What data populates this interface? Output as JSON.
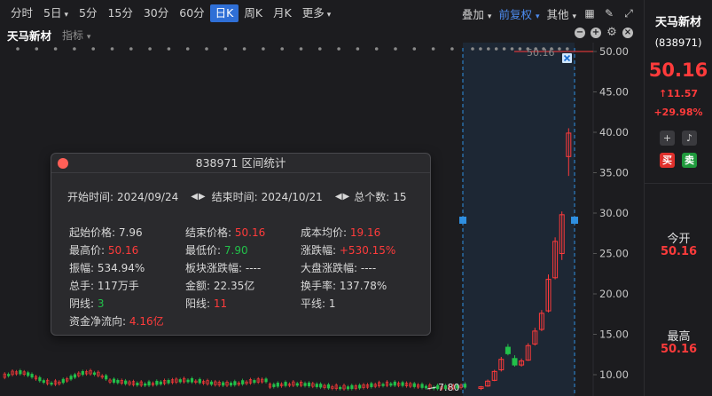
{
  "toolbar": {
    "periods": [
      "分时",
      "5日",
      "5分",
      "15分",
      "30分",
      "60分",
      "日K",
      "周K",
      "月K",
      "更多"
    ],
    "active_period": "日K",
    "adjust": "叠加",
    "fuquan": "前复权",
    "other": "其他"
  },
  "chart": {
    "stock_name": "天马新材",
    "indicator_label": "指标",
    "last_price_tag": "50.16",
    "low_label": "7.80",
    "y_ticks": [
      "50.00",
      "45.00",
      "40.00",
      "35.00",
      "30.00",
      "25.00",
      "20.00",
      "15.00",
      "10.00"
    ]
  },
  "chart_data": {
    "type": "candlestick",
    "y_range": [
      8.5,
      50.5
    ],
    "y_ticks": [
      50,
      45,
      40,
      35,
      30,
      25,
      20,
      15,
      10
    ],
    "recent_candles": [
      {
        "open": 8.3,
        "close": 8.5,
        "high": 8.6,
        "low": 8.1
      },
      {
        "open": 8.6,
        "close": 9.2,
        "high": 9.4,
        "low": 8.5
      },
      {
        "open": 9.3,
        "close": 10.4,
        "high": 10.6,
        "low": 9.2
      },
      {
        "open": 10.6,
        "close": 11.9,
        "high": 12.2,
        "low": 10.4
      },
      {
        "open": 13.4,
        "close": 12.6,
        "high": 13.8,
        "low": 12.4
      },
      {
        "open": 12.0,
        "close": 11.2,
        "high": 12.4,
        "low": 11.0
      },
      {
        "open": 11.2,
        "close": 11.7,
        "high": 12.0,
        "low": 11.0
      },
      {
        "open": 11.8,
        "close": 13.6,
        "high": 13.9,
        "low": 11.7
      },
      {
        "open": 13.8,
        "close": 15.4,
        "high": 15.8,
        "low": 13.6
      },
      {
        "open": 15.6,
        "close": 17.6,
        "high": 18.0,
        "low": 15.4
      },
      {
        "open": 17.9,
        "close": 21.8,
        "high": 22.4,
        "low": 17.7
      },
      {
        "open": 22.0,
        "close": 26.5,
        "high": 27.0,
        "low": 21.8
      },
      {
        "open": 25.0,
        "close": 29.8,
        "high": 30.2,
        "low": 24.2
      },
      {
        "open": 37.0,
        "close": 39.9,
        "high": 40.5,
        "low": 34.6
      }
    ]
  },
  "popup": {
    "title": "838971 区间统计",
    "start_label": "开始时间:",
    "start_value": "2024/09/24",
    "end_label": "结束时间:",
    "end_value": "2024/10/21",
    "count_label": "总个数:",
    "count_value": "15",
    "start_price_label": "起始价格:",
    "start_price": "7.96",
    "end_price_label": "结束价格:",
    "end_price": "50.16",
    "avg_cost_label": "成本均价:",
    "avg_cost": "19.16",
    "high_label": "最高价:",
    "high": "50.16",
    "low_label": "最低价:",
    "low": "7.90",
    "change_label": "涨跌幅:",
    "change": "+530.15%",
    "amplitude_label": "振幅:",
    "amplitude": "534.94%",
    "sector_change_label": "板块涨跌幅:",
    "sector_change": "----",
    "market_change_label": "大盘涨跌幅:",
    "market_change": "----",
    "volume_label": "总手:",
    "volume": "117万手",
    "amount_label": "金额:",
    "amount": "22.35亿",
    "turnover_label": "换手率:",
    "turnover": "137.78%",
    "down_days_label": "阴线:",
    "down_days": "3",
    "up_days_label": "阳线:",
    "up_days": "11",
    "flat_days_label": "平线:",
    "flat_days": "1",
    "net_flow_label": "资金净流向:",
    "net_flow": "4.16亿"
  },
  "sidebar": {
    "name": "天马新材",
    "code": "(838971)",
    "price": "50.16",
    "change": "↑11.57",
    "pct": "+29.98%",
    "buy": "买",
    "sell": "卖",
    "open_label": "今开",
    "open_value": "50.16",
    "high_label": "最高",
    "high_value": "50.16"
  },
  "colors": {
    "up": "#ff3b3b",
    "down": "#22c04a",
    "accent": "#2f6fd6",
    "selection": "#1f8fe0"
  }
}
